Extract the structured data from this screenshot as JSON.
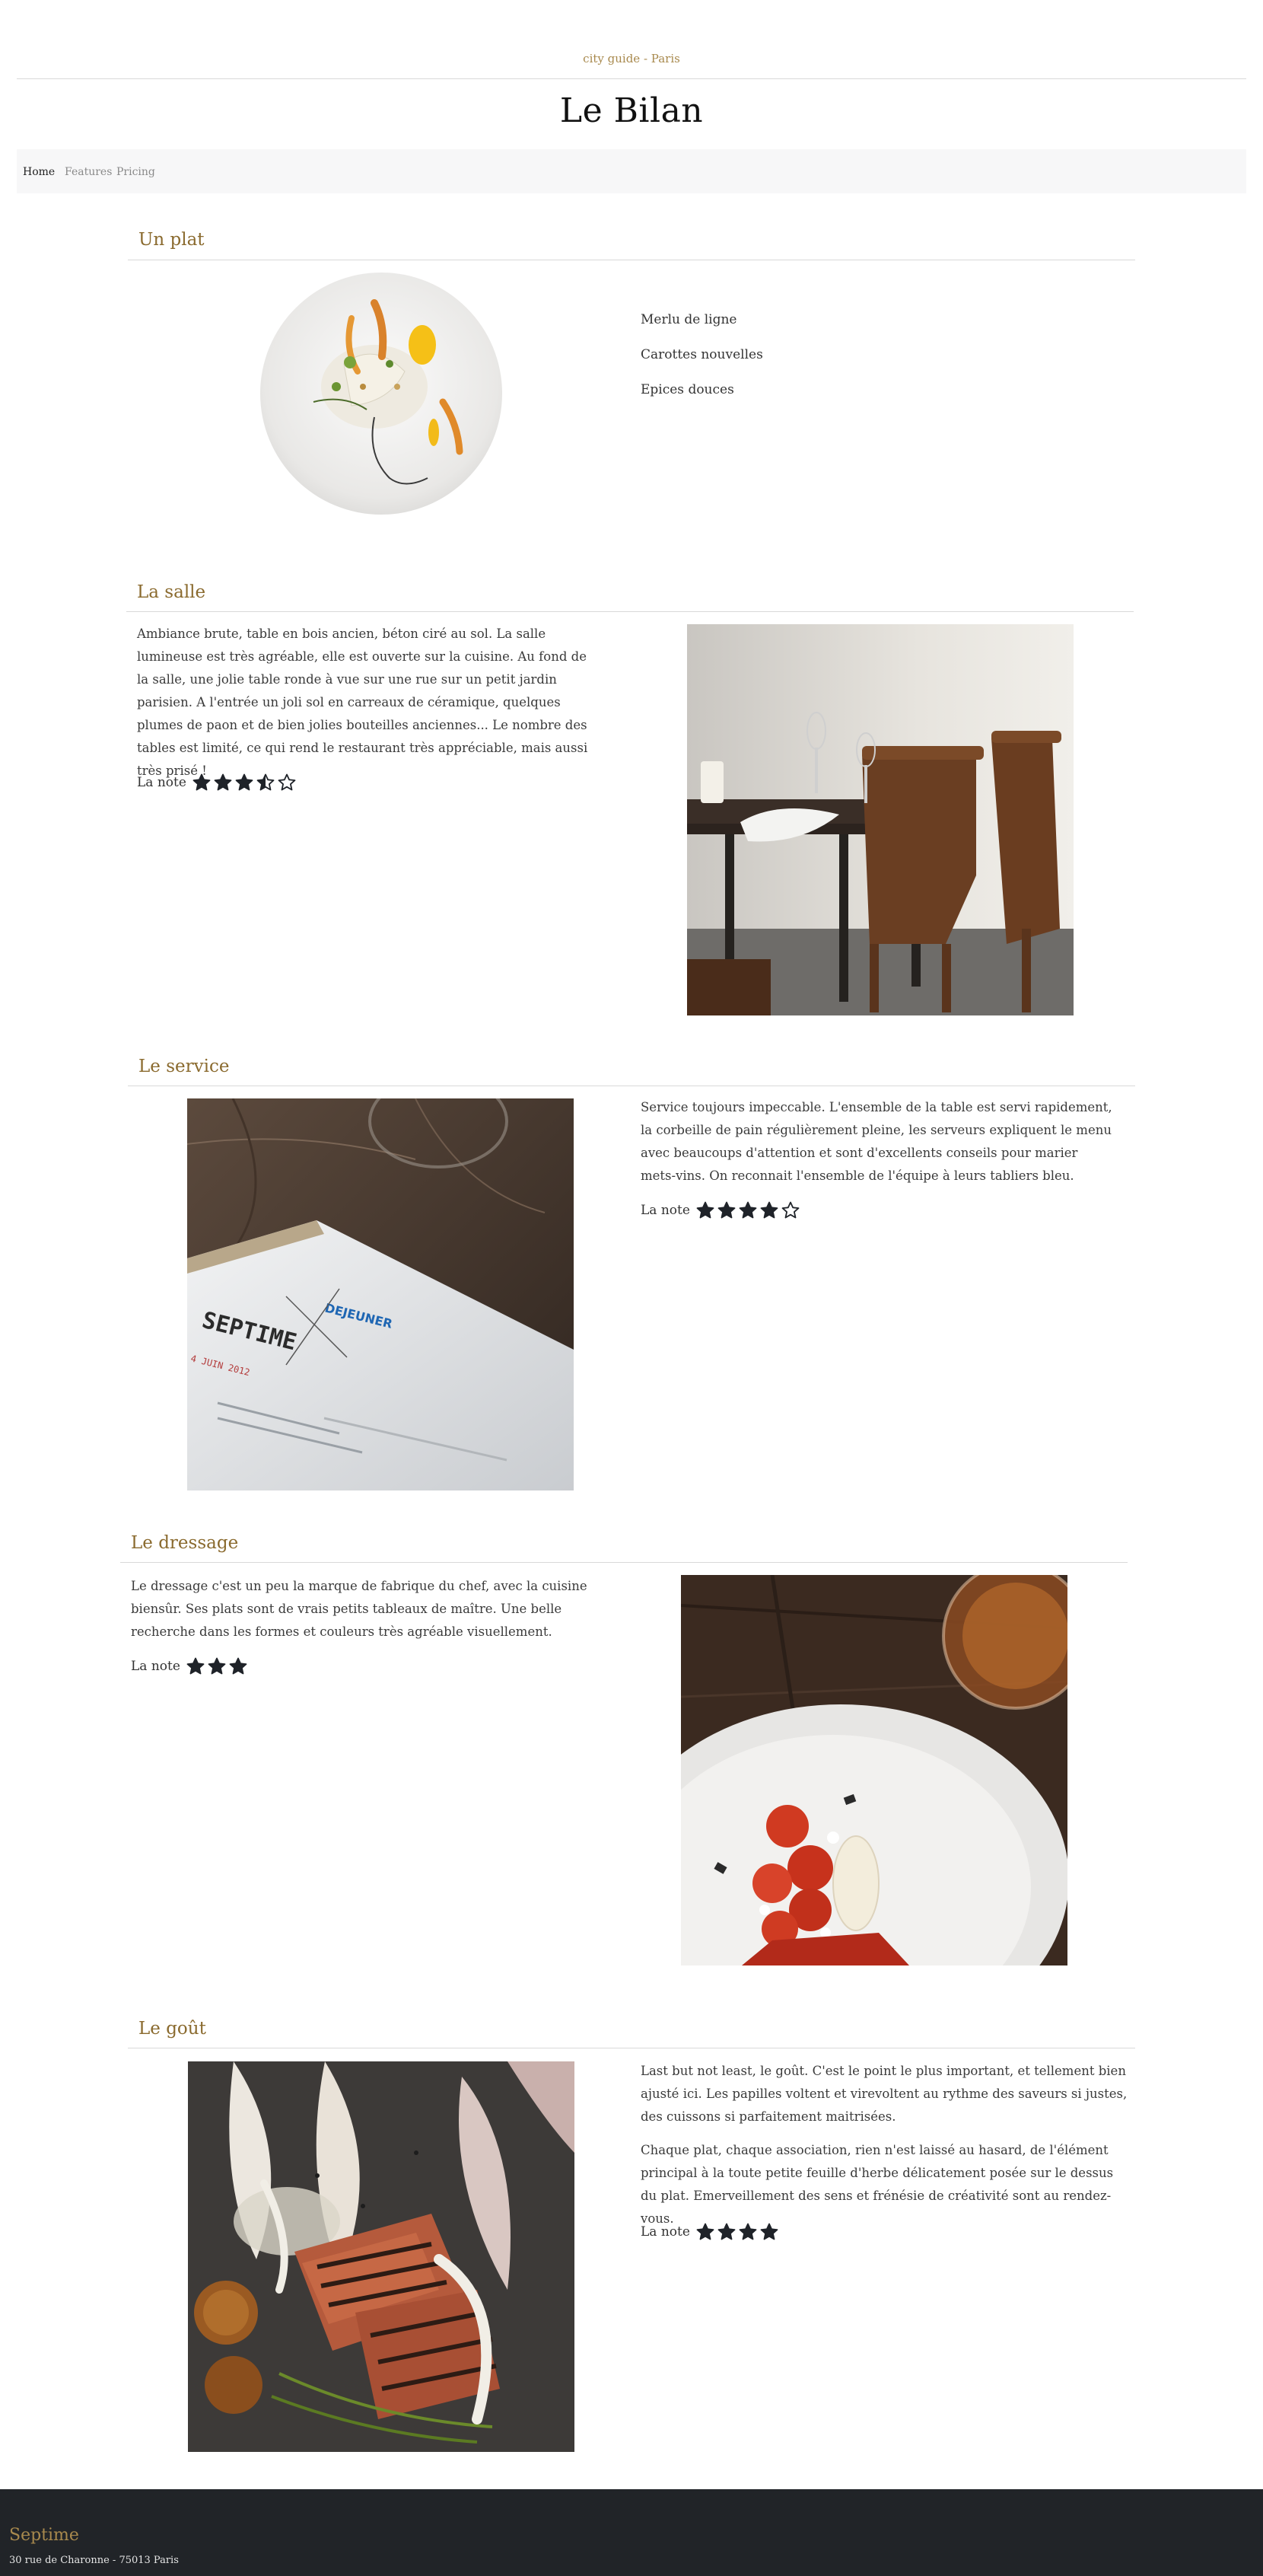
{
  "header": {
    "kicker": "city guide - Paris",
    "brand": "Le Bilan"
  },
  "nav": {
    "items": [
      {
        "label": "Home",
        "active": true
      },
      {
        "label": "Features",
        "active": false
      },
      {
        "label": "Pricing",
        "active": false
      }
    ]
  },
  "sections": {
    "plat": {
      "title": "Un plat",
      "ingredients": [
        "Merlu de ligne",
        "Carottes nouvelles",
        "Epices douces"
      ]
    },
    "salle": {
      "title": "La salle",
      "text": "Ambiance brute, table en bois ancien, béton ciré au sol. La salle lumineuse est très agréable, elle est ouverte sur la cuisine. Au fond de la salle, une jolie table ronde à vue sur une rue sur un petit jardin parisien. A l'entrée un joli sol en carreaux de céramique, quelques plumes de paon et de bien jolies bouteilles anciennes... Le nombre des tables est limité, ce qui rend le restaurant très appréciable, mais aussi très prisé !",
      "rating_label": "La note",
      "rating": 3.5,
      "rating_max": 5
    },
    "service": {
      "title": "Le service",
      "text": "Service toujours impeccable. L'ensemble de la table est servi rapidement, la corbeille de pain régulièrement pleine, les serveurs expliquent le menu avec beaucoups d'attention et sont d'excellents conseils pour marier mets-vins. On reconnait l'ensemble de l'équipe à leurs tabliers bleu.",
      "rating_label": "La note",
      "rating": 4,
      "rating_max": 5,
      "menu_card": {
        "brand": "SEPTIME",
        "meal": "DEJEUNER",
        "date": "4 JUIN 2012"
      }
    },
    "dressage": {
      "title": "Le dressage",
      "text": "Le dressage c'est un peu la marque de fabrique du chef, avec la cuisine biensûr. Ses plats sont de vrais petits tableaux de maître. Une belle recherche dans les formes et couleurs très agréable visuellement.",
      "rating_label": "La note",
      "rating": 3,
      "rating_max": 3
    },
    "gout": {
      "title": "Le goût",
      "text1": "Last but not least, le goût. C'est le point le plus important, et tellement bien ajusté ici. Les papilles voltent et virevoltent au rythme des saveurs si justes, des cuissons si parfaitement maitrisées.",
      "text2": "Chaque plat, chaque association, rien n'est laissé au hasard, de l'élément principal à la toute petite feuille d'herbe délicatement posée sur le dessus du plat. Emerveillement des sens et frénésie de créativité sont au rendez-vous.",
      "rating_label": "La note",
      "rating": 4,
      "rating_max": 4
    }
  },
  "footer": {
    "title": "Septime",
    "address": "30 rue de Charonne - 75013 Paris"
  },
  "colors": {
    "accent": "#8a6a2e",
    "footer_bg": "#212428",
    "star": "#1f2329"
  }
}
